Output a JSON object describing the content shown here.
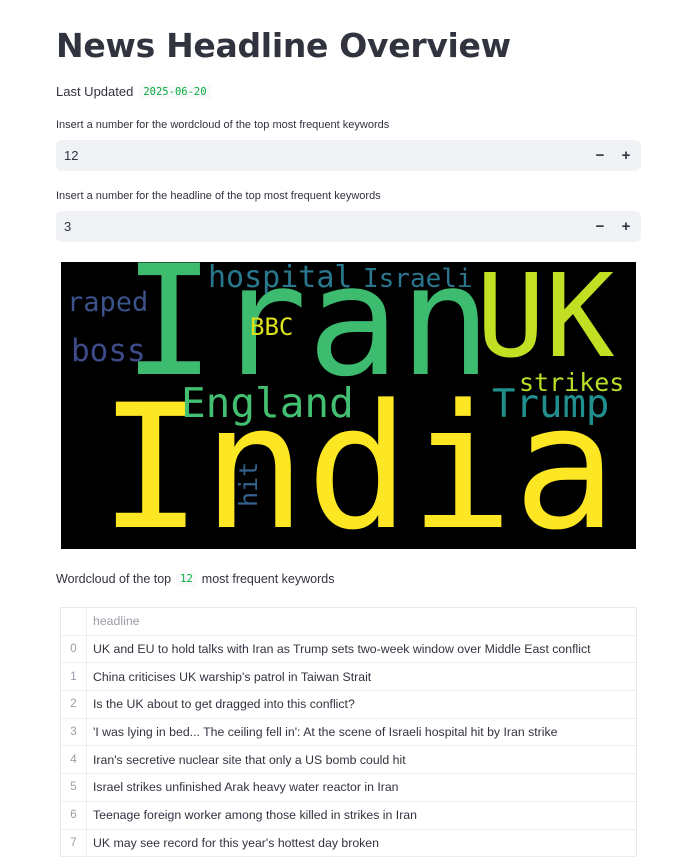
{
  "page": {
    "title": "News Headline Overview",
    "last_updated_label": "Last Updated",
    "last_updated_value": "2025-06-20"
  },
  "inputs": {
    "wordcloud_count": {
      "label": "Insert a number for the wordcloud of the top most frequent keywords",
      "value": "12",
      "minus": "−",
      "plus": "+"
    },
    "headline_count": {
      "label": "Insert a number for the headline of the top most frequent keywords",
      "value": "3",
      "minus": "−",
      "plus": "+"
    }
  },
  "wordcloud": {
    "words": [
      {
        "text": "India",
        "color": "#fde725"
      },
      {
        "text": "Iran",
        "color": "#3dbb6e"
      },
      {
        "text": "UK",
        "color": "#c2df23"
      },
      {
        "text": "England",
        "color": "#43bf71"
      },
      {
        "text": "Trump",
        "color": "#218f8d"
      },
      {
        "text": "hospital",
        "color": "#29788e"
      },
      {
        "text": "Israeli",
        "color": "#2a768e"
      },
      {
        "text": "BBC",
        "color": "#dde318"
      },
      {
        "text": "strikes",
        "color": "#b8de29"
      },
      {
        "text": "raped",
        "color": "#3b528b"
      },
      {
        "text": "boss",
        "color": "#3e4a89"
      },
      {
        "text": "hit",
        "color": "#33638d"
      }
    ]
  },
  "caption": {
    "prefix": "Wordcloud of the top",
    "value": "12",
    "suffix": "most frequent keywords"
  },
  "table": {
    "header": "headline",
    "rows": [
      {
        "index": "0",
        "headline": "UK and EU to hold talks with Iran as Trump sets two-week window over Middle East conflict"
      },
      {
        "index": "1",
        "headline": "China criticises UK warship's patrol in Taiwan Strait"
      },
      {
        "index": "2",
        "headline": "Is the UK about to get dragged into this conflict?"
      },
      {
        "index": "3",
        "headline": "'I was lying in bed... The ceiling fell in': At the scene of Israeli hospital hit by Iran strike"
      },
      {
        "index": "4",
        "headline": "Iran's secretive nuclear site that only a US bomb could hit"
      },
      {
        "index": "5",
        "headline": "Israel strikes unfinished Arak heavy water reactor in Iran"
      },
      {
        "index": "6",
        "headline": "Teenage foreign worker among those killed in strikes in Iran"
      },
      {
        "index": "7",
        "headline": "UK may see record for this year's hottest day broken"
      }
    ]
  }
}
